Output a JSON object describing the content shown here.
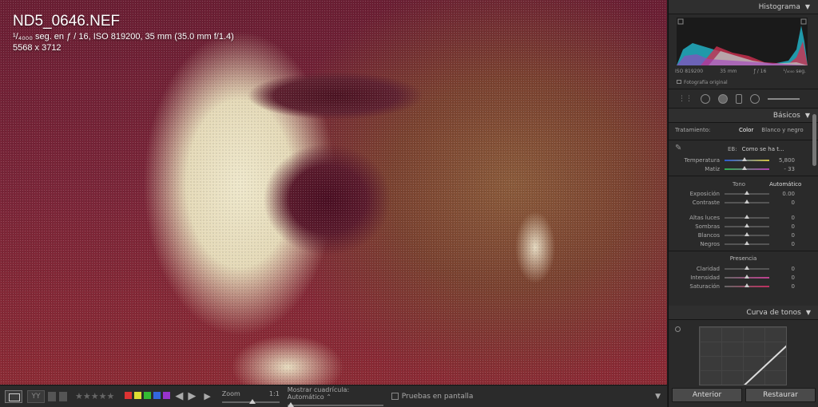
{
  "photo": {
    "file_name": "ND5_0646.NEF",
    "exposure_line": "¹/₄₀₀₀ seg. en ƒ / 16, ISO 819200, 35 mm (35.0 mm f/1.4)",
    "dimensions": "5568 x 3712"
  },
  "toolbar": {
    "stars": "★★★★★",
    "zoom_label": "Zoom",
    "zoom_value": "1:1",
    "grid_label": "Mostrar cuadrícula:",
    "grid_value": "Automático",
    "screen_proof_label": "Pruebas en pantalla",
    "color_labels": [
      "#d33",
      "#dd3",
      "#3b3",
      "#36d",
      "#93c"
    ]
  },
  "histogram": {
    "title": "Histograma",
    "iso": "ISO 819200",
    "focal": "35 mm",
    "aperture": "ƒ / 16",
    "shutter": "¹/₄₀₀₀ seg.",
    "original_photo": "Fotografía original"
  },
  "basics": {
    "title": "Básicos",
    "treatment_label": "Tratamiento:",
    "treatment_color": "Color",
    "treatment_bw": "Blanco y negro",
    "wb_label": "EB:",
    "wb_value": "Como se ha t...",
    "temperature_label": "Temperatura",
    "temperature_value": "5,800",
    "tint_label": "Matiz",
    "tint_value": "- 33",
    "tone_label": "Tono",
    "tone_auto": "Automático",
    "exposure_label": "Exposición",
    "exposure_value": "0.00",
    "contrast_label": "Contraste",
    "contrast_value": "0",
    "highlights_label": "Altas luces",
    "highlights_value": "0",
    "shadows_label": "Sombras",
    "shadows_value": "0",
    "whites_label": "Blancos",
    "whites_value": "0",
    "blacks_label": "Negros",
    "blacks_value": "0",
    "presence_label": "Presencia",
    "clarity_label": "Claridad",
    "clarity_value": "0",
    "vibrance_label": "Intensidad",
    "vibrance_value": "0",
    "saturation_label": "Saturación",
    "saturation_value": "0"
  },
  "curve": {
    "title": "Curva de tonos"
  },
  "buttons": {
    "previous": "Anterior",
    "reset": "Restaurar"
  }
}
